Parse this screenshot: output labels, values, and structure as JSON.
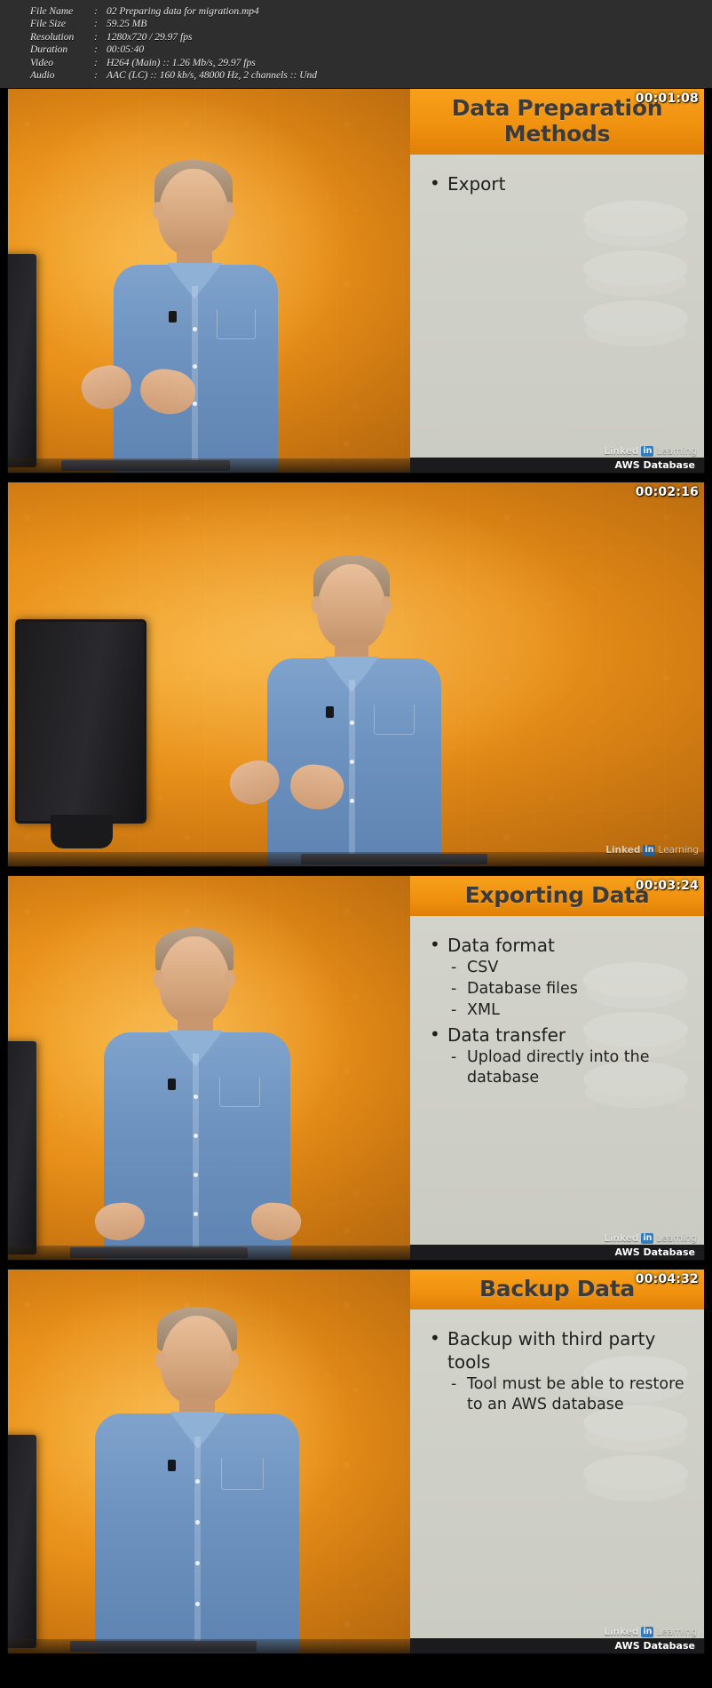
{
  "metadata": {
    "rows": [
      {
        "label": "File Name",
        "value": "02 Preparing data for migration.mp4"
      },
      {
        "label": "File Size",
        "value": "59.25 MB"
      },
      {
        "label": "Resolution",
        "value": "1280x720 / 29.97 fps"
      },
      {
        "label": "Duration",
        "value": "00:05:40"
      },
      {
        "label": "Video",
        "value": "H264 (Main) :: 1.26 Mb/s, 29.97 fps"
      },
      {
        "label": "Audio",
        "value": "AAC (LC) :: 160 kb/s, 48000 Hz, 2 channels :: Und"
      }
    ],
    "separator": ":"
  },
  "watermark": {
    "linked": "Linked",
    "in_badge": "in",
    "learning": "Learning",
    "course": "AWS Database"
  },
  "panels": [
    {
      "timestamp": "00:01:08",
      "layout": "split",
      "slide": {
        "title": "Data Preparation Methods",
        "bullets": [
          {
            "text": "Export",
            "sub": []
          }
        ]
      }
    },
    {
      "timestamp": "00:02:16",
      "layout": "full",
      "slide": null
    },
    {
      "timestamp": "00:03:24",
      "layout": "split",
      "slide": {
        "title": "Exporting Data",
        "bullets": [
          {
            "text": "Data format",
            "sub": [
              "CSV",
              "Database files",
              "XML"
            ]
          },
          {
            "text": "Data transfer",
            "sub": [
              "Upload directly into the database"
            ]
          }
        ]
      }
    },
    {
      "timestamp": "00:04:32",
      "layout": "split",
      "slide": {
        "title": "Backup Data",
        "bullets": [
          {
            "text": "Backup with third party tools",
            "sub": [
              "Tool must be able to restore to an AWS database"
            ]
          }
        ]
      }
    }
  ],
  "colors": {
    "accent_orange": "#f0920f",
    "slide_bg": "#cfd0c8",
    "header_bg": "#2e2e2e",
    "shirt_blue": "#6e93c0",
    "linkedin_blue": "#0a66c2"
  }
}
